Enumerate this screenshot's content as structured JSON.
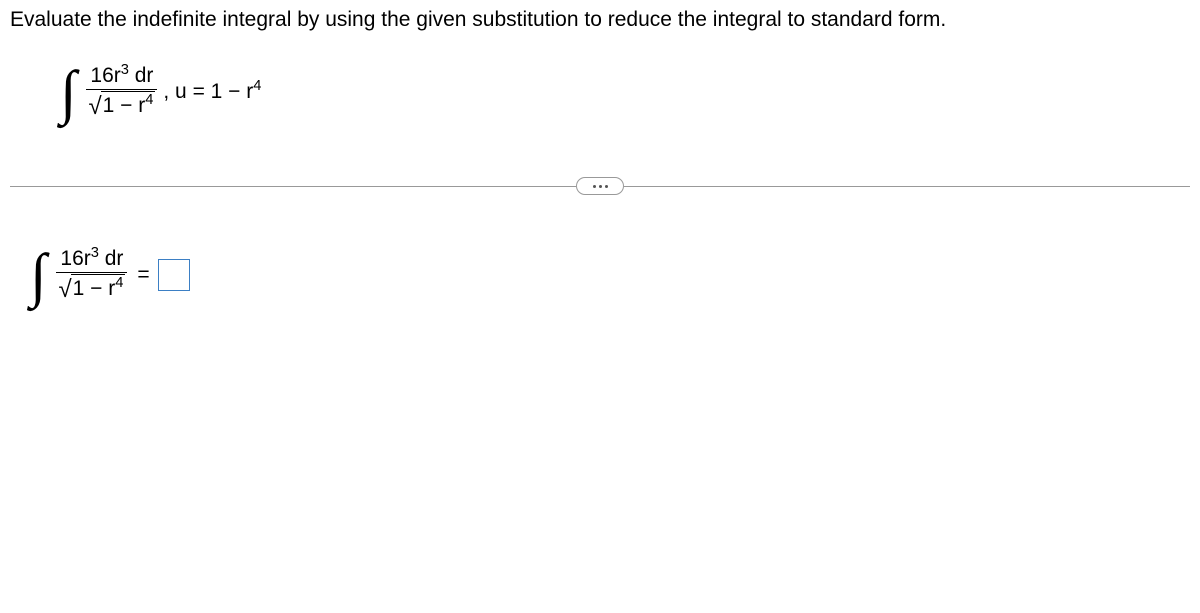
{
  "question": "Evaluate the indefinite integral by using the given substitution to reduce the integral to standard form.",
  "problem": {
    "numerator_coeff": "16r",
    "numerator_sup": "3",
    "numerator_after": " dr",
    "denom_pre": "1 − r",
    "denom_sup": "4",
    "substitution_prefix": ", u = 1 − r",
    "substitution_sup": "4"
  },
  "answer": {
    "numerator_coeff": "16r",
    "numerator_sup": "3",
    "numerator_after": " dr",
    "denom_pre": "1 − r",
    "denom_sup": "4",
    "equals": "="
  },
  "ellipsis": "..."
}
